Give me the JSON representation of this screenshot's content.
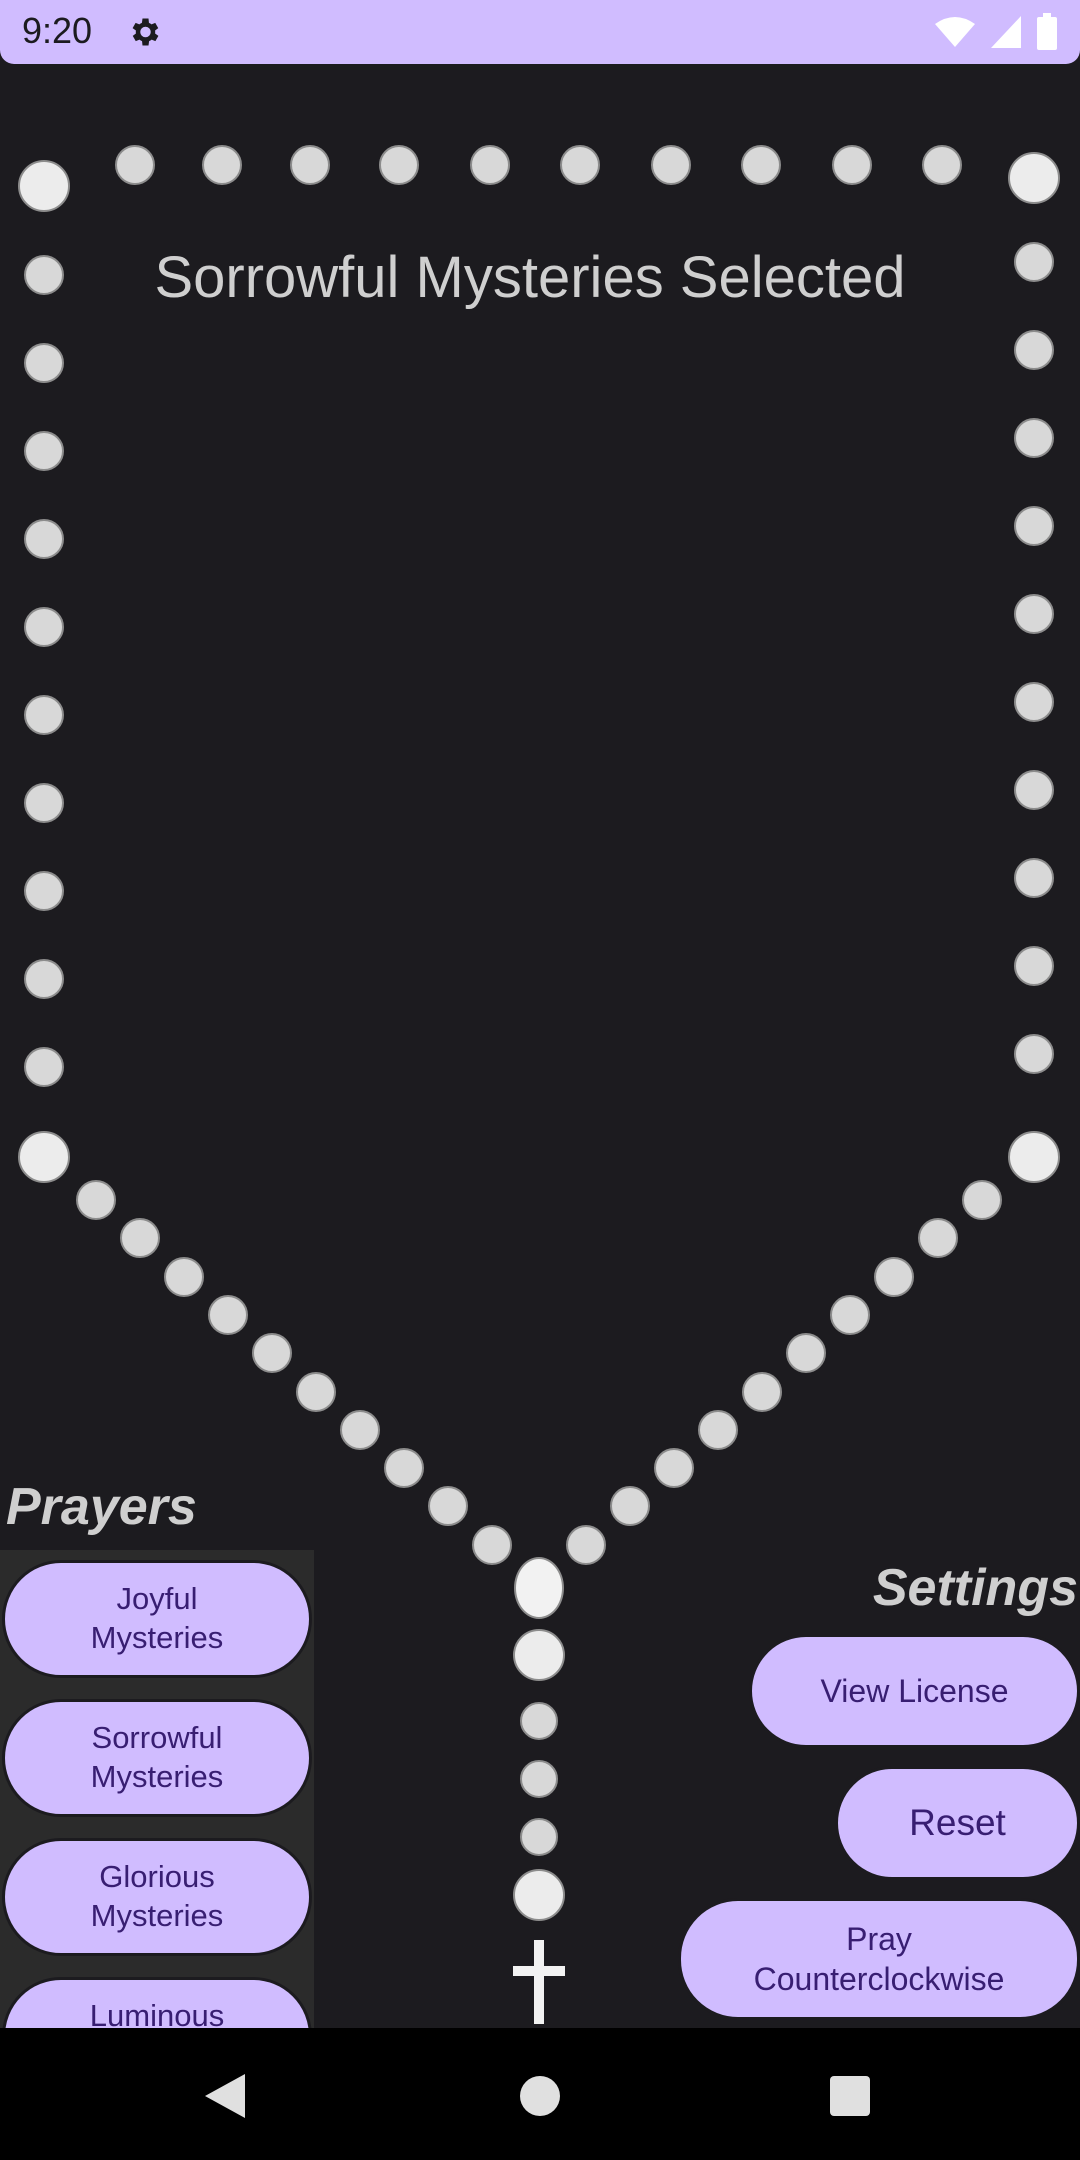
{
  "status_bar": {
    "time": "9:20",
    "icons": [
      "settings-gear-icon",
      "wifi-icon",
      "signal-icon",
      "battery-icon"
    ],
    "color": "#d0bcff"
  },
  "main": {
    "title": "Sorrowful Mysteries Selected"
  },
  "prayers": {
    "heading": "Prayers",
    "items": [
      {
        "label": "Joyful\nMysteries"
      },
      {
        "label": "Sorrowful\nMysteries"
      },
      {
        "label": "Glorious\nMysteries"
      },
      {
        "label": "Luminous\nMysteries"
      }
    ]
  },
  "settings": {
    "heading": "Settings",
    "view_license": "View License",
    "reset": "Reset",
    "pray_direction": "Pray\nCounterclockwise"
  },
  "navigation": {
    "icons": [
      "back-icon",
      "home-icon",
      "recents-icon"
    ]
  },
  "colors": {
    "accent": "#d0bcff",
    "accent_text": "#381e72",
    "background": "#1c1b1f",
    "bead": "#d8d8d8"
  }
}
